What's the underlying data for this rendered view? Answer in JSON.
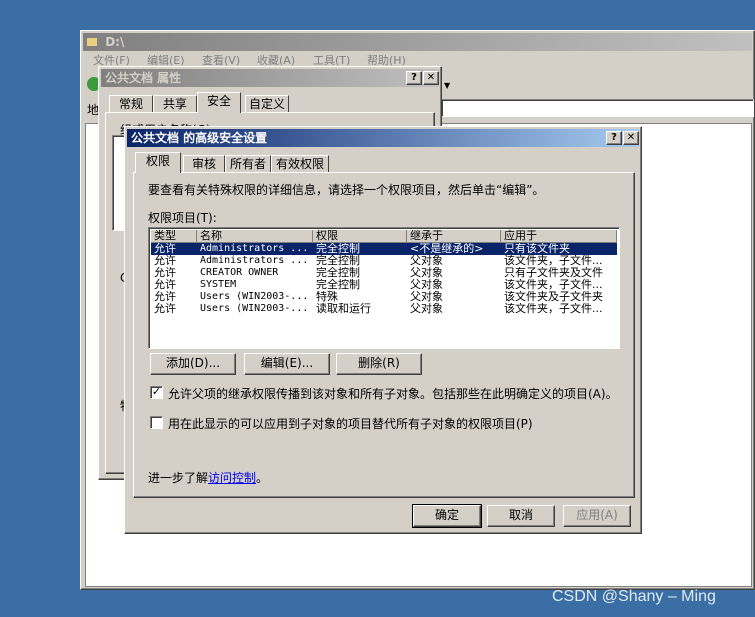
{
  "explorer": {
    "title": "D:\\",
    "menu": [
      "文件(F)",
      "编辑(E)",
      "查看(V)",
      "收藏(A)",
      "工具(T)",
      "帮助(H)"
    ],
    "address_label": "地"
  },
  "props_dialog": {
    "title": "公共文档 属性",
    "tabs": [
      "常规",
      "共享",
      "安全",
      "自定义"
    ],
    "active_tab": "安全",
    "group_label": "组或用户名称(G):",
    "partial_c": "C",
    "partial_te": "特"
  },
  "adv_dialog": {
    "title": "公共文档 的高级安全设置",
    "tabs": [
      "权限",
      "审核",
      "所有者",
      "有效权限"
    ],
    "active_tab": "权限",
    "intro": "要查看有关特殊权限的详细信息，请选择一个权限项目，然后单击“编辑”。",
    "list_label": "权限项目(T):",
    "columns": [
      "类型",
      "名称",
      "权限",
      "继承于",
      "应用于"
    ],
    "rows": [
      {
        "type": "允许",
        "name": "Administrators ...",
        "perm": "完全控制",
        "inherit": "<不是继承的>",
        "apply": "只有该文件夹"
      },
      {
        "type": "允许",
        "name": "Administrators ...",
        "perm": "完全控制",
        "inherit": "父对象",
        "apply": "该文件夹，子文件..."
      },
      {
        "type": "允许",
        "name": "CREATOR OWNER",
        "perm": "完全控制",
        "inherit": "父对象",
        "apply": "只有子文件夹及文件"
      },
      {
        "type": "允许",
        "name": "SYSTEM",
        "perm": "完全控制",
        "inherit": "父对象",
        "apply": "该文件夹，子文件..."
      },
      {
        "type": "允许",
        "name": "Users (WIN2003-...",
        "perm": "特殊",
        "inherit": "父对象",
        "apply": "该文件夹及子文件夹"
      },
      {
        "type": "允许",
        "name": "Users (WIN2003-...",
        "perm": "读取和运行",
        "inherit": "父对象",
        "apply": "该文件夹，子文件..."
      }
    ],
    "selected_row": 0,
    "add_button": "添加(D)...",
    "edit_button": "编辑(E)...",
    "delete_button": "删除(R)",
    "inherit_checkbox": {
      "label": "允许父项的继承权限传播到该对象和所有子对象。包括那些在此明确定义的项目(A)。",
      "checked": true
    },
    "replace_checkbox": {
      "label": "用在此显示的可以应用到子对象的项目替代所有子对象的权限项目(P)",
      "checked": false
    },
    "learn_more_prefix": "进一步了解",
    "learn_more_link": "访问控制",
    "learn_more_suffix": "。",
    "ok_button": "确定",
    "cancel_button": "取消",
    "apply_button": "应用(A)"
  },
  "watermark": "CSDN @Shany – Ming"
}
